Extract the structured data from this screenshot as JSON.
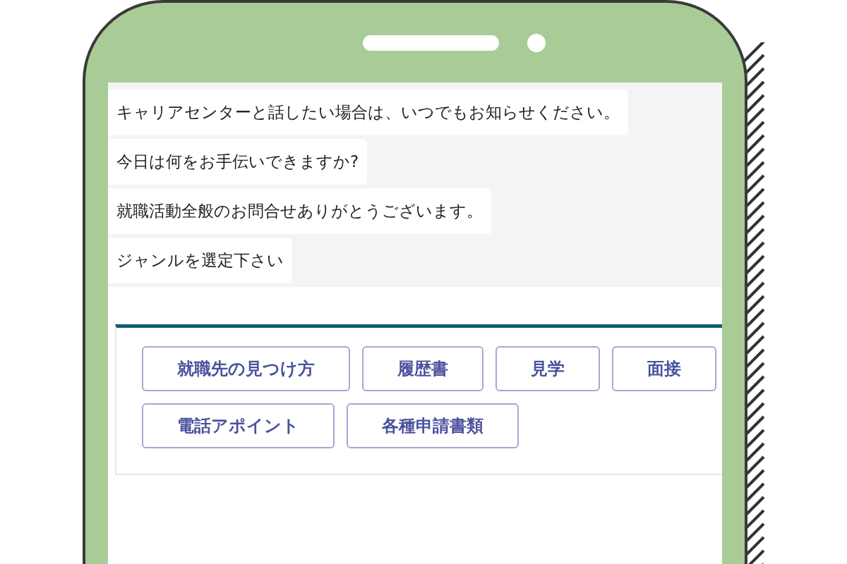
{
  "messages": [
    {
      "text": "キャリアセンターと話したい場合は、いつでもお知らせください。"
    },
    {
      "text": "今日は何をお手伝いできますか?"
    },
    {
      "text": "就職活動全般のお問合せありがとうございます。"
    },
    {
      "text": "ジャンルを選定下さい"
    }
  ],
  "genre_buttons": [
    [
      "就職先の見つけ方",
      "履歴書",
      "見学",
      "面接"
    ],
    [
      "電話アポイント",
      "各種申請書類"
    ]
  ]
}
